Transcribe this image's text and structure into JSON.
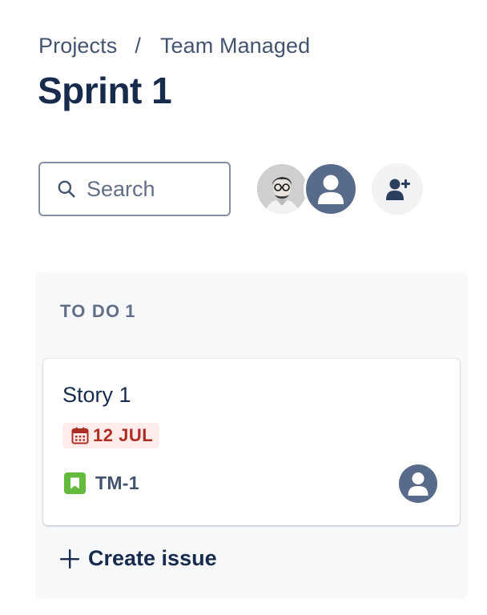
{
  "breadcrumb": {
    "items": [
      "Projects",
      "Team Managed"
    ],
    "separator": "/"
  },
  "page": {
    "title": "Sprint 1"
  },
  "search": {
    "placeholder": "Search",
    "value": ""
  },
  "people": {
    "avatars": [
      "user-photo-avatar",
      "generic-user-avatar"
    ],
    "add_button_icon": "add-person-icon"
  },
  "board": {
    "columns": [
      {
        "name": "TO DO",
        "count": "1",
        "cards": [
          {
            "title": "Story 1",
            "due_date": "12 JUL",
            "issue_type": "story",
            "key": "TM-1"
          }
        ],
        "create_label": "Create issue"
      }
    ]
  },
  "colors": {
    "text": "#172b4d",
    "subtle_text": "#44546f",
    "column_bg": "#f7f8f9",
    "overdue_bg": "#ffeceb",
    "overdue_text": "#ae2e24",
    "story_green": "#63ba3c",
    "avatar_bg": "#596b8a"
  }
}
